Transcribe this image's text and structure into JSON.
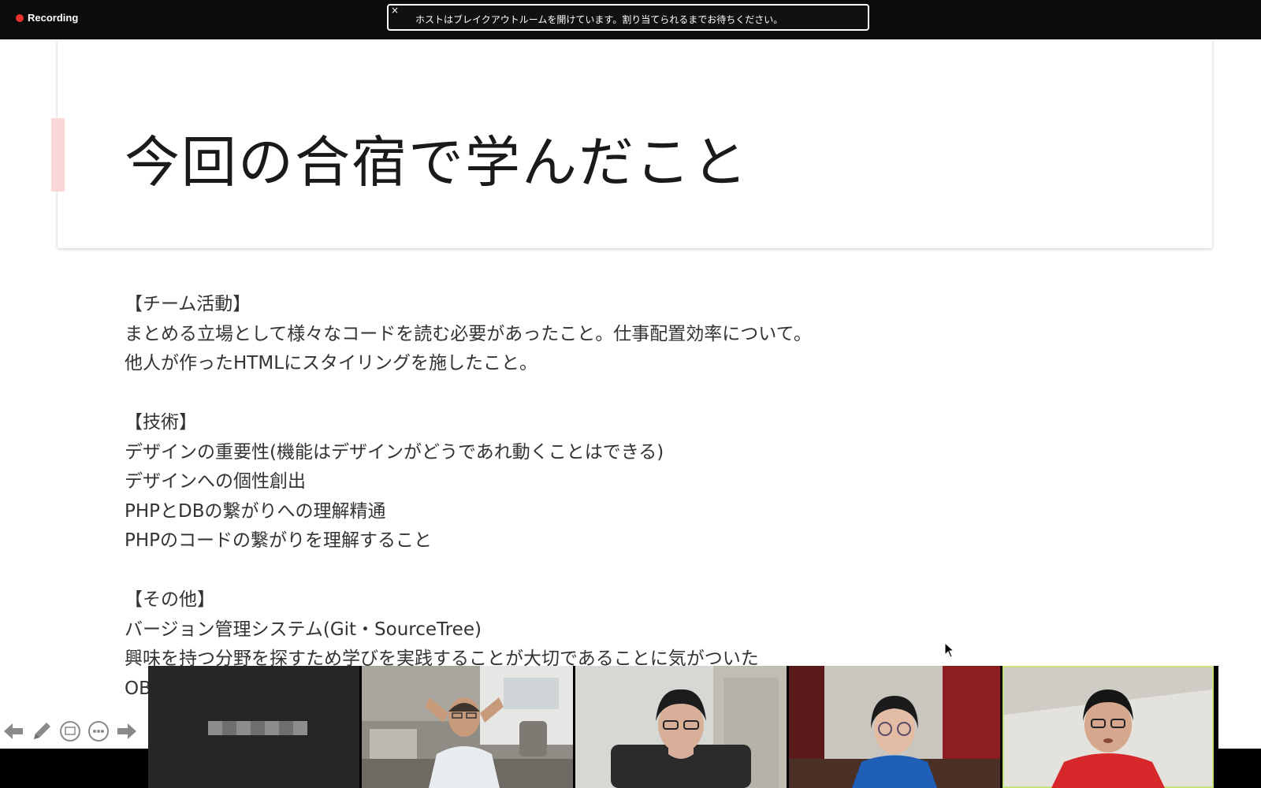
{
  "recording": {
    "label": "Recording",
    "dot_color": "#e8332e"
  },
  "notice": {
    "text": "ホストはブレイクアウトルームを開けています。割り当てられるまでお待ちください。",
    "close_glyph": "×"
  },
  "slide": {
    "title": "今回の合宿で学んだこと",
    "accent_color": "#fbd6d9",
    "lines": [
      "【チーム活動】",
      "まとめる立場として様々なコードを読む必要があったこと。仕事配置効率について。",
      "他人が作ったHTMLにスタイリングを施したこと。",
      "",
      "【技術】",
      "デザインの重要性(機能はデザインがどうであれ動くことはできる)",
      "デザインへの個性創出",
      "PHPとDBの繋がりへの理解精通",
      "PHPのコードの繋がりを理解すること",
      "",
      "【その他】",
      "バージョン管理システム(Git・SourceTree)",
      "興味を持つ分野を探すため学びを実践することが大切であることに気がついた",
      "OB"
    ]
  },
  "toolbar": {
    "icons": [
      "arrow-left-icon",
      "pencil-icon",
      "screen-icon",
      "more-icon",
      "arrow-right-icon"
    ]
  },
  "participants": [
    {
      "kind": "blank",
      "name_hidden": true
    },
    {
      "kind": "video",
      "scene": "office",
      "shirt": "#e9ecef"
    },
    {
      "kind": "video",
      "scene": "room-door",
      "shirt": "#2a2a2a"
    },
    {
      "kind": "video",
      "scene": "curtains",
      "shirt": "#1f5fb8"
    },
    {
      "kind": "video",
      "scene": "plain-wall",
      "shirt": "#d6282b",
      "active": true
    }
  ],
  "colors": {
    "active_border": "#c8e27a",
    "topbar": "#0c0c0c"
  }
}
